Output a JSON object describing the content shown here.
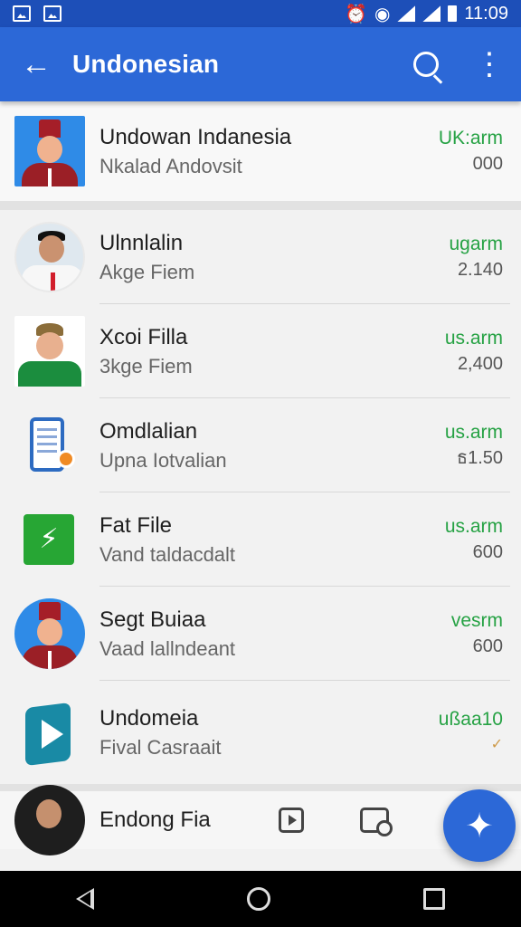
{
  "status": {
    "time": "11:09",
    "left_icons": [
      "image-notification-icon",
      "gallery-notification-icon"
    ],
    "right_icons": [
      "alarm-icon",
      "wifi-icon",
      "signal-icon",
      "battery-icon"
    ]
  },
  "app_bar": {
    "title": "Undonesian",
    "search_icon": "search-icon",
    "menu_icon": "more-vert-icon"
  },
  "featured": {
    "title": "Undowan Indanesia",
    "subtitle": "Nkalad Andovsit",
    "tag": "UK:arm",
    "value": "000"
  },
  "rows": [
    {
      "title": "Ulnnlalin",
      "subtitle": "Akge Fiem",
      "tag": "ugarm",
      "value": "2.140"
    },
    {
      "title": "Xcoi Filla",
      "subtitle": "3kge Fiem",
      "tag": "us.arm",
      "value": "2,400"
    },
    {
      "title": "Omdlalian",
      "subtitle": "Upna Iotvalian",
      "tag": "us.arm",
      "value": "ธ1.50"
    },
    {
      "title": "Fat File",
      "subtitle": "Vand taldacdalt",
      "tag": "us.arm",
      "value": "600"
    },
    {
      "title": "Segt Buiaa",
      "subtitle": "Vaad lallndeant",
      "tag": "vesrm",
      "value": "600"
    },
    {
      "title": "Undomeia",
      "subtitle": "Fival Casraait",
      "tag": "ußaa10",
      "value": "✓"
    }
  ],
  "partial": {
    "title": "Endong Fia"
  },
  "fab_icon": "sparkle-icon",
  "navigation": [
    "back",
    "home",
    "recent"
  ]
}
